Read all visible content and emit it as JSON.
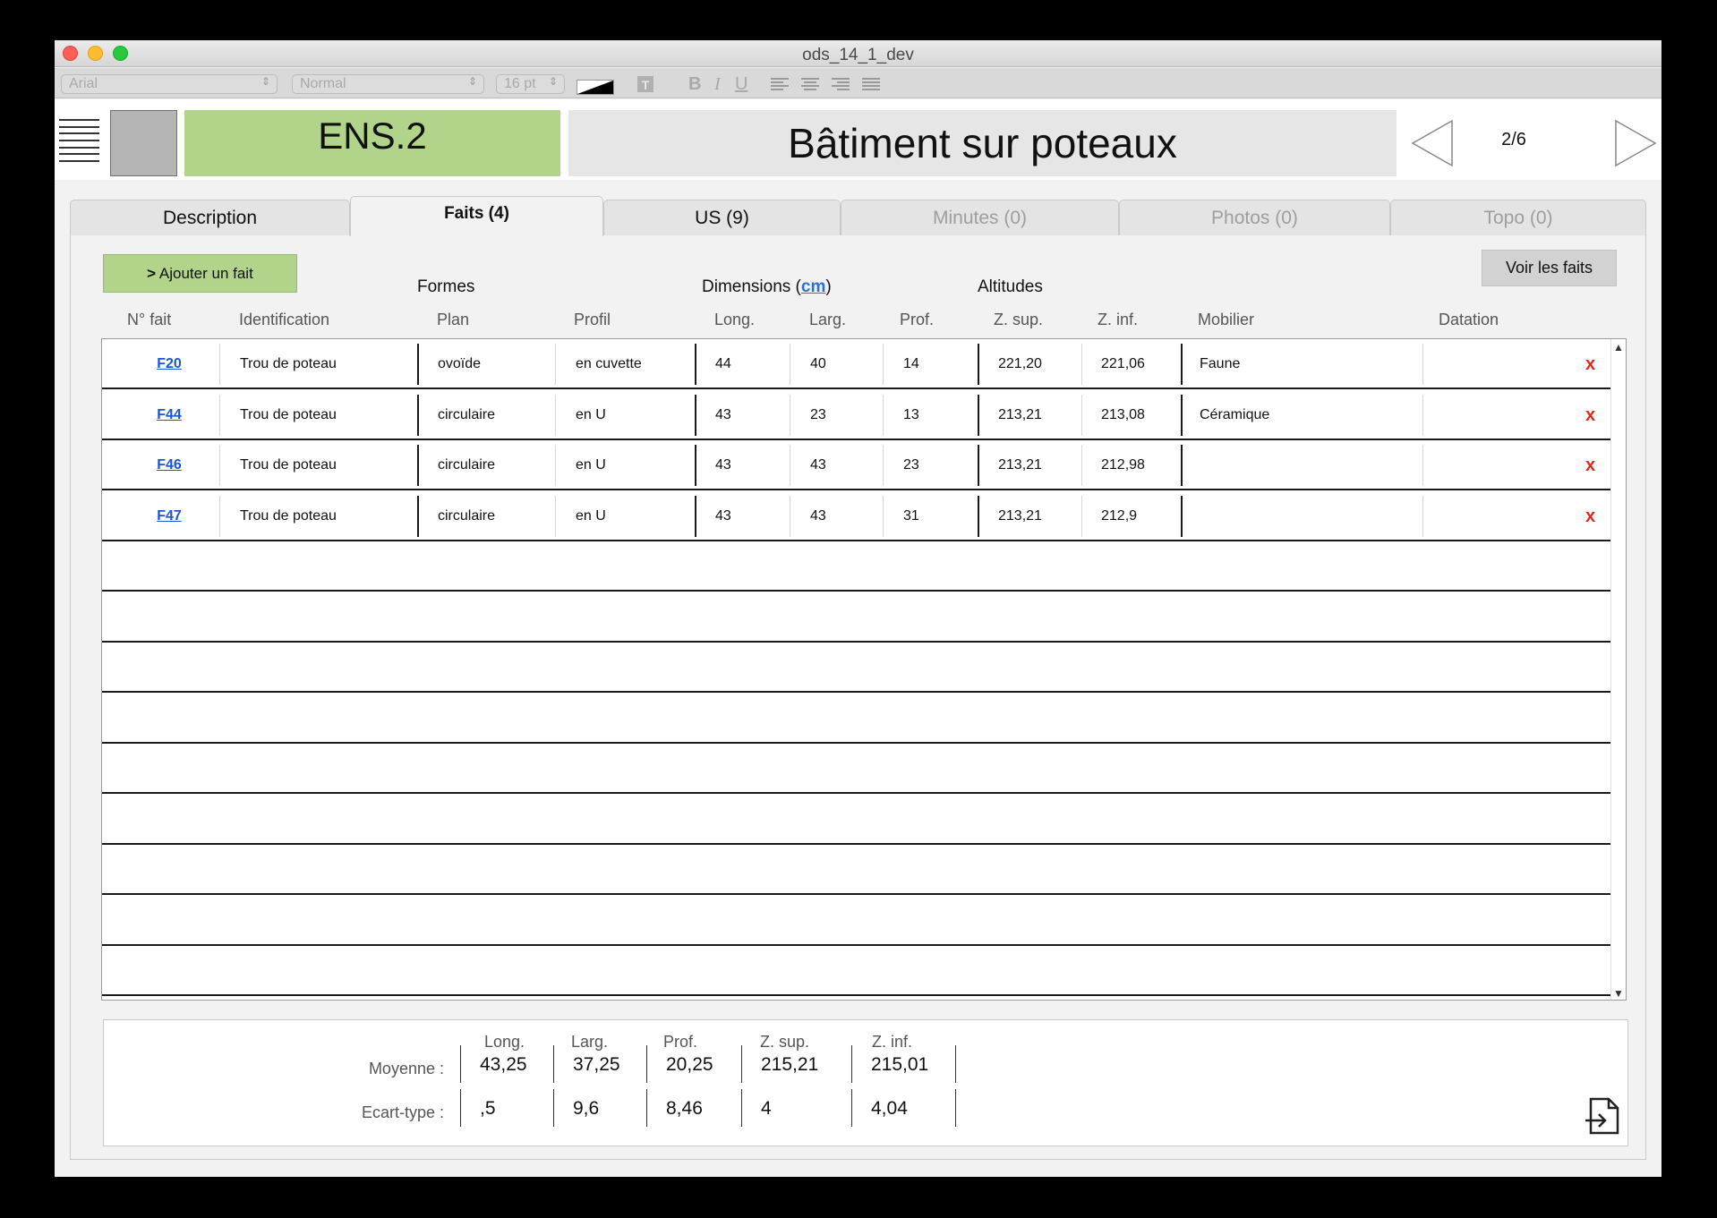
{
  "window": {
    "title": "ods_14_1_dev"
  },
  "format_toolbar": {
    "font": "Arial",
    "style": "Normal",
    "size": "16 pt",
    "bold": "B",
    "italic": "I",
    "underline": "U"
  },
  "header": {
    "code": "ENS.2",
    "title": "Bâtiment sur poteaux",
    "page": "2/6"
  },
  "tabs": [
    {
      "label": "Description",
      "state": "normal"
    },
    {
      "label": "Faits (4)",
      "state": "active"
    },
    {
      "label": "US (9)",
      "state": "normal"
    },
    {
      "label": "Minutes (0)",
      "state": "disabled"
    },
    {
      "label": "Photos (0)",
      "state": "disabled"
    },
    {
      "label": "Topo (0)",
      "state": "disabled"
    }
  ],
  "buttons": {
    "add": "Ajouter un fait",
    "add_prefix": ">",
    "view": "Voir les faits"
  },
  "groups": {
    "formes": "Formes",
    "dimensions": "Dimensions (",
    "dimensions_unit": "cm",
    "dimensions_close": ")",
    "altitudes": "Altitudes"
  },
  "columns": [
    "N° fait",
    "Identification",
    "Plan",
    "Profil",
    "Long.",
    "Larg.",
    "Prof.",
    "Z. sup.",
    "Z. inf.",
    "Mobilier",
    "Datation"
  ],
  "rows": [
    {
      "id": "F20",
      "ident": "Trou de poteau",
      "plan": "ovoïde",
      "profil": "en cuvette",
      "long": "44",
      "larg": "40",
      "prof": "14",
      "zsup": "221,20",
      "zinf": "221,06",
      "mobilier": "Faune",
      "datation": "",
      "del": "x"
    },
    {
      "id": "F44",
      "ident": "Trou de poteau",
      "plan": "circulaire",
      "profil": "en U",
      "long": "43",
      "larg": "23",
      "prof": "13",
      "zsup": "213,21",
      "zinf": "213,08",
      "mobilier": "Céramique",
      "datation": "",
      "del": "x"
    },
    {
      "id": "F46",
      "ident": "Trou de poteau",
      "plan": "circulaire",
      "profil": "en U",
      "long": "43",
      "larg": "43",
      "prof": "23",
      "zsup": "213,21",
      "zinf": "212,98",
      "mobilier": "",
      "datation": "",
      "del": "x"
    },
    {
      "id": "F47",
      "ident": "Trou de poteau",
      "plan": "circulaire",
      "profil": "en U",
      "long": "43",
      "larg": "43",
      "prof": "31",
      "zsup": "213,21",
      "zinf": "212,9",
      "mobilier": "",
      "datation": "",
      "del": "x"
    }
  ],
  "stats": {
    "headers": [
      "Long.",
      "Larg.",
      "Prof.",
      "Z. sup.",
      "Z. inf."
    ],
    "mean_label": "Moyenne :",
    "std_label": "Ecart-type :",
    "mean": [
      "43,25",
      "37,25",
      "20,25",
      "215,21",
      "215,01"
    ],
    "std": [
      ",5",
      "9,6",
      "8,46",
      "4",
      "4,04"
    ]
  },
  "colors": {
    "green": "#b1d48a",
    "link": "#1a55d6",
    "delete": "#e0281e"
  }
}
